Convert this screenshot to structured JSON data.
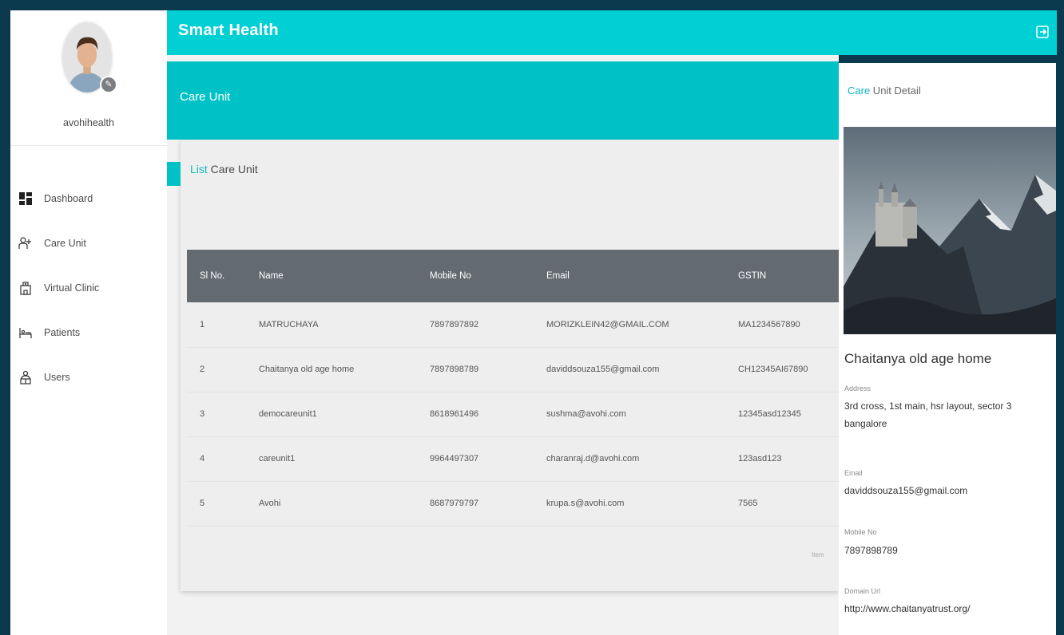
{
  "app": {
    "title": "Smart Health"
  },
  "user": {
    "name": "avohihealth"
  },
  "sidebar": {
    "items": [
      {
        "label": "Dashboard",
        "icon": "dashboard-icon"
      },
      {
        "label": "Care Unit",
        "icon": "care-unit-icon"
      },
      {
        "label": "Virtual Clinic",
        "icon": "clinic-icon"
      },
      {
        "label": "Patients",
        "icon": "patients-icon"
      },
      {
        "label": "Users",
        "icon": "users-icon"
      }
    ]
  },
  "page": {
    "title": "Care Unit"
  },
  "list": {
    "title_accent": "List",
    "title_rest": " Care Unit",
    "columns": [
      "Sl No.",
      "Name",
      "Mobile No",
      "Email",
      "GSTIN"
    ],
    "rows": [
      {
        "sl": "1",
        "name": "MATRUCHAYA",
        "mobile": "7897897892",
        "email": "MORIZKLEIN42@GMAIL.COM",
        "gstin": "MA1234567890"
      },
      {
        "sl": "2",
        "name": "Chaitanya old age home",
        "mobile": "7897898789",
        "email": "daviddsouza155@gmail.com",
        "gstin": "CH12345AI67890"
      },
      {
        "sl": "3",
        "name": "democareunit1",
        "mobile": "8618961496",
        "email": "sushma@avohi.com",
        "gstin": "12345asd12345"
      },
      {
        "sl": "4",
        "name": "careunit1",
        "mobile": "9964497307",
        "email": "charanraj.d@avohi.com",
        "gstin": "123asd123"
      },
      {
        "sl": "5",
        "name": "Avohi",
        "mobile": "8687979797",
        "email": "krupa.s@avohi.com",
        "gstin": "7565"
      }
    ],
    "footer_text": "Item"
  },
  "detail": {
    "title_accent": "Care",
    "title_rest": " Unit Detail",
    "name": "Chaitanya old age home",
    "address_label": "Address",
    "address": "3rd cross, 1st main, hsr layout, sector 3 bangalore",
    "email_label": "Email",
    "email": "daviddsouza155@gmail.com",
    "mobile_label": "Mobile No",
    "mobile": "7897898789",
    "domain_label": "Domain Url",
    "domain": "http://www.chaitanyatrust.org/"
  },
  "colors": {
    "topbar": "#00d0d4",
    "banner": "#00c2c6",
    "accent_text": "#10b8bd",
    "table_header": "#646b70",
    "frame": "#0b3a4f"
  }
}
